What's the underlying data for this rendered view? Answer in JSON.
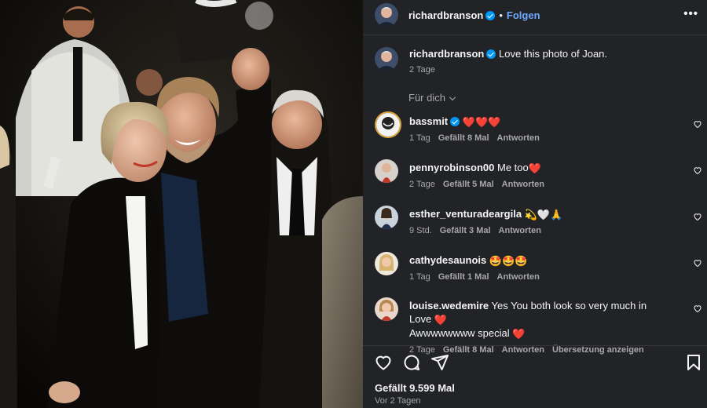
{
  "post": {
    "author": "richardbranson",
    "separator": "•",
    "follow_label": "Folgen",
    "more_label": "•••"
  },
  "caption": {
    "author": "richardbranson",
    "text": "Love this photo of Joan.",
    "time": "2 Tage"
  },
  "filter": {
    "label": "Für dich"
  },
  "comments": [
    {
      "user": "bassmit",
      "verified": true,
      "text": "",
      "emoji": "❤️❤️❤️",
      "time": "1 Tag",
      "likes": "Gefällt 8 Mal",
      "reply": "Antworten"
    },
    {
      "user": "pennyrobinson00",
      "verified": false,
      "text": "Me too",
      "emoji": "❤️",
      "time": "2 Tage",
      "likes": "Gefällt 5 Mal",
      "reply": "Antworten"
    },
    {
      "user": "esther_venturadeargila",
      "verified": false,
      "text": "",
      "emoji": "💫🤍🙏",
      "time": "9 Std.",
      "likes": "Gefällt 3 Mal",
      "reply": "Antworten"
    },
    {
      "user": "cathydesaunois",
      "verified": false,
      "text": "",
      "emoji": "🤩🤩🤩",
      "time": "1 Tag",
      "likes": "Gefällt 1 Mal",
      "reply": "Antworten"
    },
    {
      "user": "louise.wedemire",
      "verified": false,
      "text": "Yes You both look so very much in Love",
      "emoji": "❤️",
      "text2": "Awwwwwwww special",
      "emoji2": "❤️",
      "time": "2 Tage",
      "likes": "Gefällt 8 Mal",
      "reply": "Antworten",
      "translate": "Übersetzung anzeigen"
    }
  ],
  "footer": {
    "likes": "Gefällt 9.599 Mal",
    "date": "Vor 2 Tagen"
  },
  "colors": {
    "panel_bg": "#222327",
    "link_blue": "#6ea8ff",
    "verified_blue": "#0095f6",
    "muted_text": "#a8a8a8"
  },
  "icons": [
    "more-icon",
    "heart-icon",
    "comment-icon",
    "share-icon",
    "bookmark-icon",
    "verified-icon",
    "chevron-down-icon"
  ]
}
